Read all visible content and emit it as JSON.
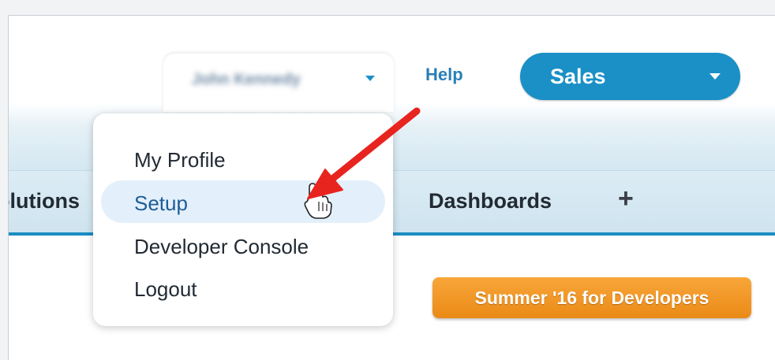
{
  "header": {
    "user_name": "John Kennedy",
    "help_label": "Help",
    "app_switcher_label": "Sales"
  },
  "tabs": [
    {
      "label": "Solutions"
    },
    {
      "label": "Dashboards"
    }
  ],
  "tab_add_label": "+",
  "user_dropdown": {
    "items": [
      {
        "label": "My Profile"
      },
      {
        "label": "Setup"
      },
      {
        "label": "Developer Console"
      },
      {
        "label": "Logout"
      }
    ]
  },
  "promo": {
    "label": "Summer '16 for Developers"
  },
  "colors": {
    "accent": "#1a90c6",
    "arrow": "#e8241f",
    "promo": "#ea8a16",
    "highlight": "#e3f0fb"
  },
  "icons": [
    "chevron-down-icon",
    "plus-icon",
    "hand-pointer-icon",
    "red-arrow-icon"
  ]
}
